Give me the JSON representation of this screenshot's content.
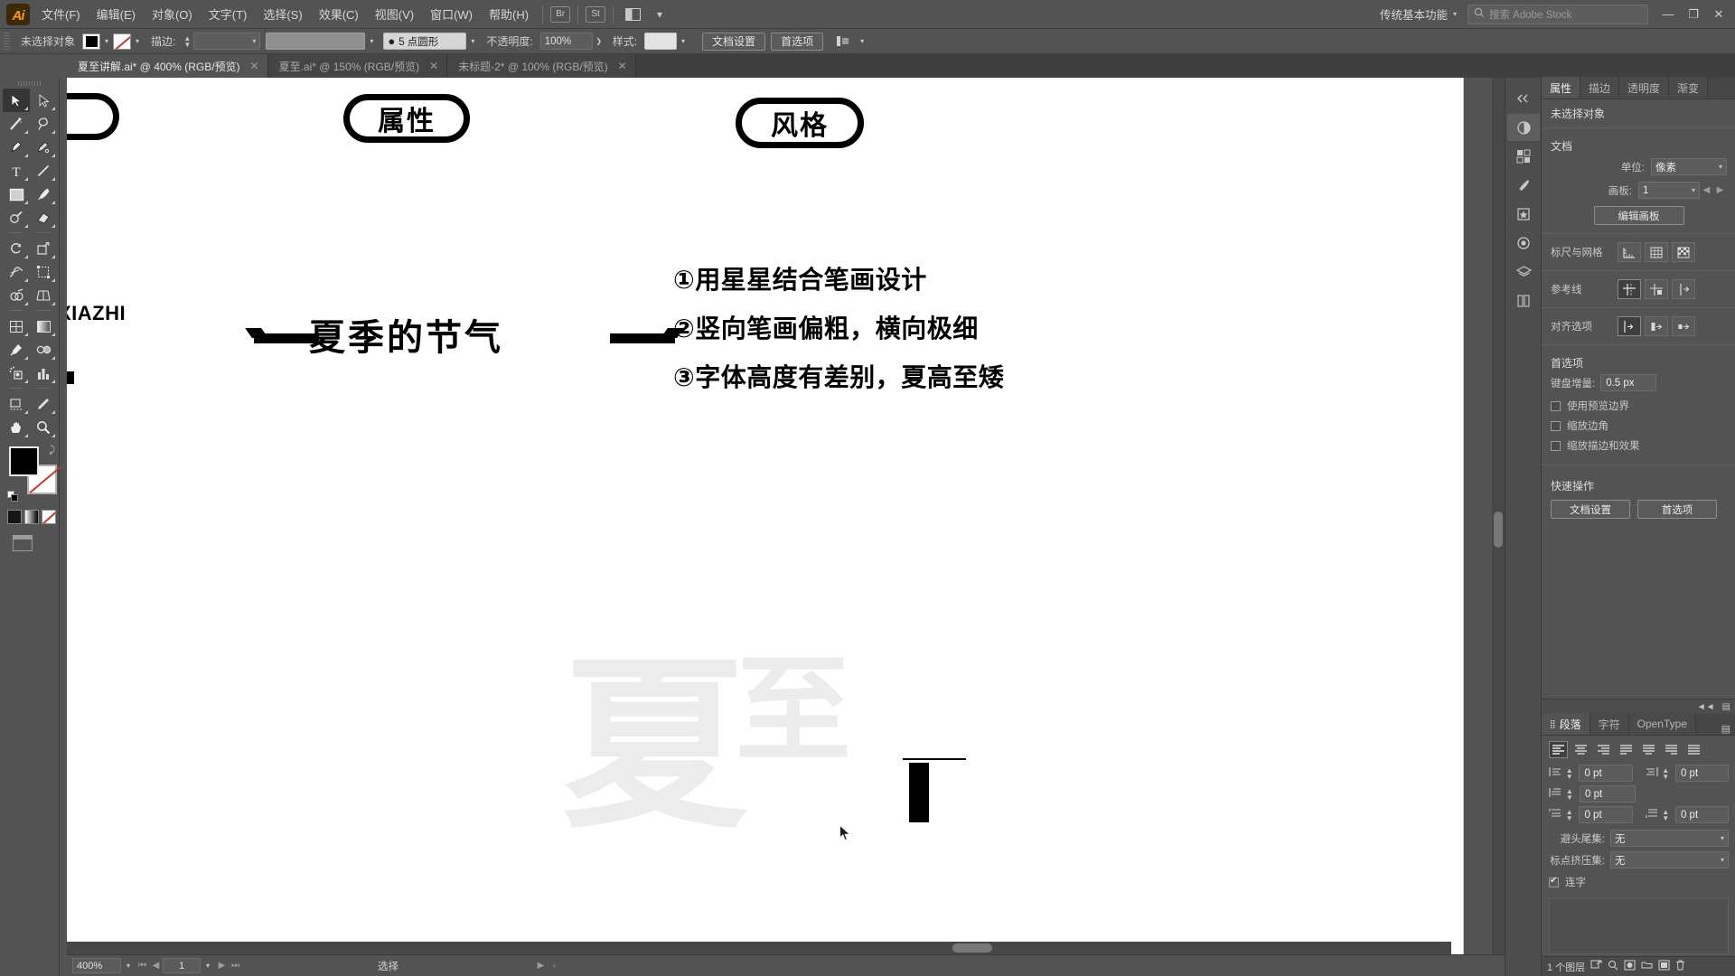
{
  "app": {
    "name": "Adobe Illustrator",
    "logo": "Ai"
  },
  "menubar": {
    "items": [
      {
        "label": "文件(F)",
        "name": "menu-file"
      },
      {
        "label": "编辑(E)",
        "name": "menu-edit"
      },
      {
        "label": "对象(O)",
        "name": "menu-object"
      },
      {
        "label": "文字(T)",
        "name": "menu-type"
      },
      {
        "label": "选择(S)",
        "name": "menu-select"
      },
      {
        "label": "效果(C)",
        "name": "menu-effect"
      },
      {
        "label": "视图(V)",
        "name": "menu-view"
      },
      {
        "label": "窗口(W)",
        "name": "menu-window"
      },
      {
        "label": "帮助(H)",
        "name": "menu-help"
      }
    ],
    "bridge_icon": "br-icon",
    "stock_icon": "st-icon",
    "arrange_icon": "arrange-documents-icon",
    "workspace": "传统基本功能",
    "search_placeholder": "搜索 Adobe Stock",
    "window_buttons": {
      "minimize": "—",
      "maximize": "❐",
      "close": "✕"
    }
  },
  "controlbar": {
    "selection_status": "未选择对象",
    "fill_label": "fill-swatch",
    "stroke_label": "stroke-swatch",
    "stroke_text": "描边:",
    "stroke_weight": "",
    "brush_value": "",
    "profile": "5 点圆形",
    "opacity_label": "不透明度:",
    "opacity_value": "100%",
    "style_label": "样式:",
    "doc_setup": "文档设置",
    "preferences": "首选项"
  },
  "tabs": [
    {
      "title": "夏至讲解.ai* @ 400% (RGB/预览)",
      "active": true
    },
    {
      "title": "夏至.ai* @ 150% (RGB/预览)",
      "active": false
    },
    {
      "title": "未标题-2* @ 100% (RGB/预览)",
      "active": false
    }
  ],
  "toolbar": {
    "tools": [
      "selection-tool",
      "direct-selection-tool",
      "magic-wand-tool",
      "lasso-tool",
      "pen-tool",
      "curvature-tool",
      "type-tool",
      "line-segment-tool",
      "rectangle-tool",
      "paintbrush-tool",
      "shaper-tool",
      "eraser-tool",
      "rotate-tool",
      "scale-tool",
      "width-tool",
      "free-transform-tool",
      "shape-builder-tool",
      "perspective-grid-tool",
      "mesh-tool",
      "gradient-tool",
      "eyedropper-tool",
      "blend-tool",
      "symbol-sprayer-tool",
      "column-graph-tool",
      "artboard-tool",
      "slice-tool",
      "hand-tool",
      "zoom-tool"
    ],
    "fill_color": "#000000",
    "stroke_color": "#ffffff"
  },
  "canvas": {
    "zoom": "400%",
    "page": "1",
    "status": "选择",
    "artwork": {
      "pills": [
        {
          "label": "",
          "name": "pill-structure-partial"
        },
        {
          "label": "属性",
          "name": "pill-attribute"
        },
        {
          "label": "风格",
          "name": "pill-style"
        }
      ],
      "pinyin": "XIAZHI",
      "headline": "夏季的节气",
      "bullets": [
        "①用星星结合笔画设计",
        "②竖向笔画偏粗，横向极细",
        "③字体高度有差别，夏高至矮"
      ],
      "template_chars": [
        "夏",
        "至"
      ]
    }
  },
  "rightdock": {
    "panel_tabs": [
      {
        "label": "属性",
        "active": true
      },
      {
        "label": "描边",
        "active": false
      },
      {
        "label": "透明度",
        "active": false
      },
      {
        "label": "渐变",
        "active": false
      }
    ],
    "selection_status": "未选择对象",
    "document": {
      "section_label": "文档",
      "unit_label": "单位:",
      "unit_value": "像素",
      "artboard_label": "画板:",
      "artboard_value": "1",
      "edit_artboards": "编辑画板"
    },
    "rulers_grid": {
      "label": "标尺与网格"
    },
    "guides": {
      "label": "参考线"
    },
    "align_options": {
      "label": "对齐选项"
    },
    "preferences": {
      "label": "首选项",
      "keyboard_increment_label": "键盘增量:",
      "keyboard_increment_value": "0.5 px",
      "checkboxes": [
        {
          "label": "使用预览边界",
          "checked": false
        },
        {
          "label": "缩放边角",
          "checked": false
        },
        {
          "label": "缩放描边和效果",
          "checked": false
        }
      ]
    },
    "quick_actions": {
      "label": "快速操作",
      "doc_setup": "文档设置",
      "preferences": "首选项"
    },
    "paragraph_panel": {
      "tabs": [
        {
          "label": "段落",
          "active": true
        },
        {
          "label": "字符",
          "active": false
        },
        {
          "label": "OpenType",
          "active": false
        }
      ],
      "indent_left": "0 pt",
      "indent_right": "0 pt",
      "indent_first": "0 pt",
      "space_before": "0 pt",
      "space_after": "0 pt",
      "kinsoku_label": "避头尾集:",
      "kinsoku_value": "无",
      "mojikumi_label": "标点挤压集:",
      "mojikumi_value": "无",
      "hyphenate_label": "连字",
      "hyphenate_checked": true
    },
    "layers_status": "1 个图层"
  },
  "dock_icons": [
    "color-panel-icon",
    "swatches-panel-icon",
    "brushes-panel-icon",
    "symbols-panel-icon",
    "appearance-panel-icon",
    "layers-panel-icon",
    "libraries-panel-icon"
  ]
}
